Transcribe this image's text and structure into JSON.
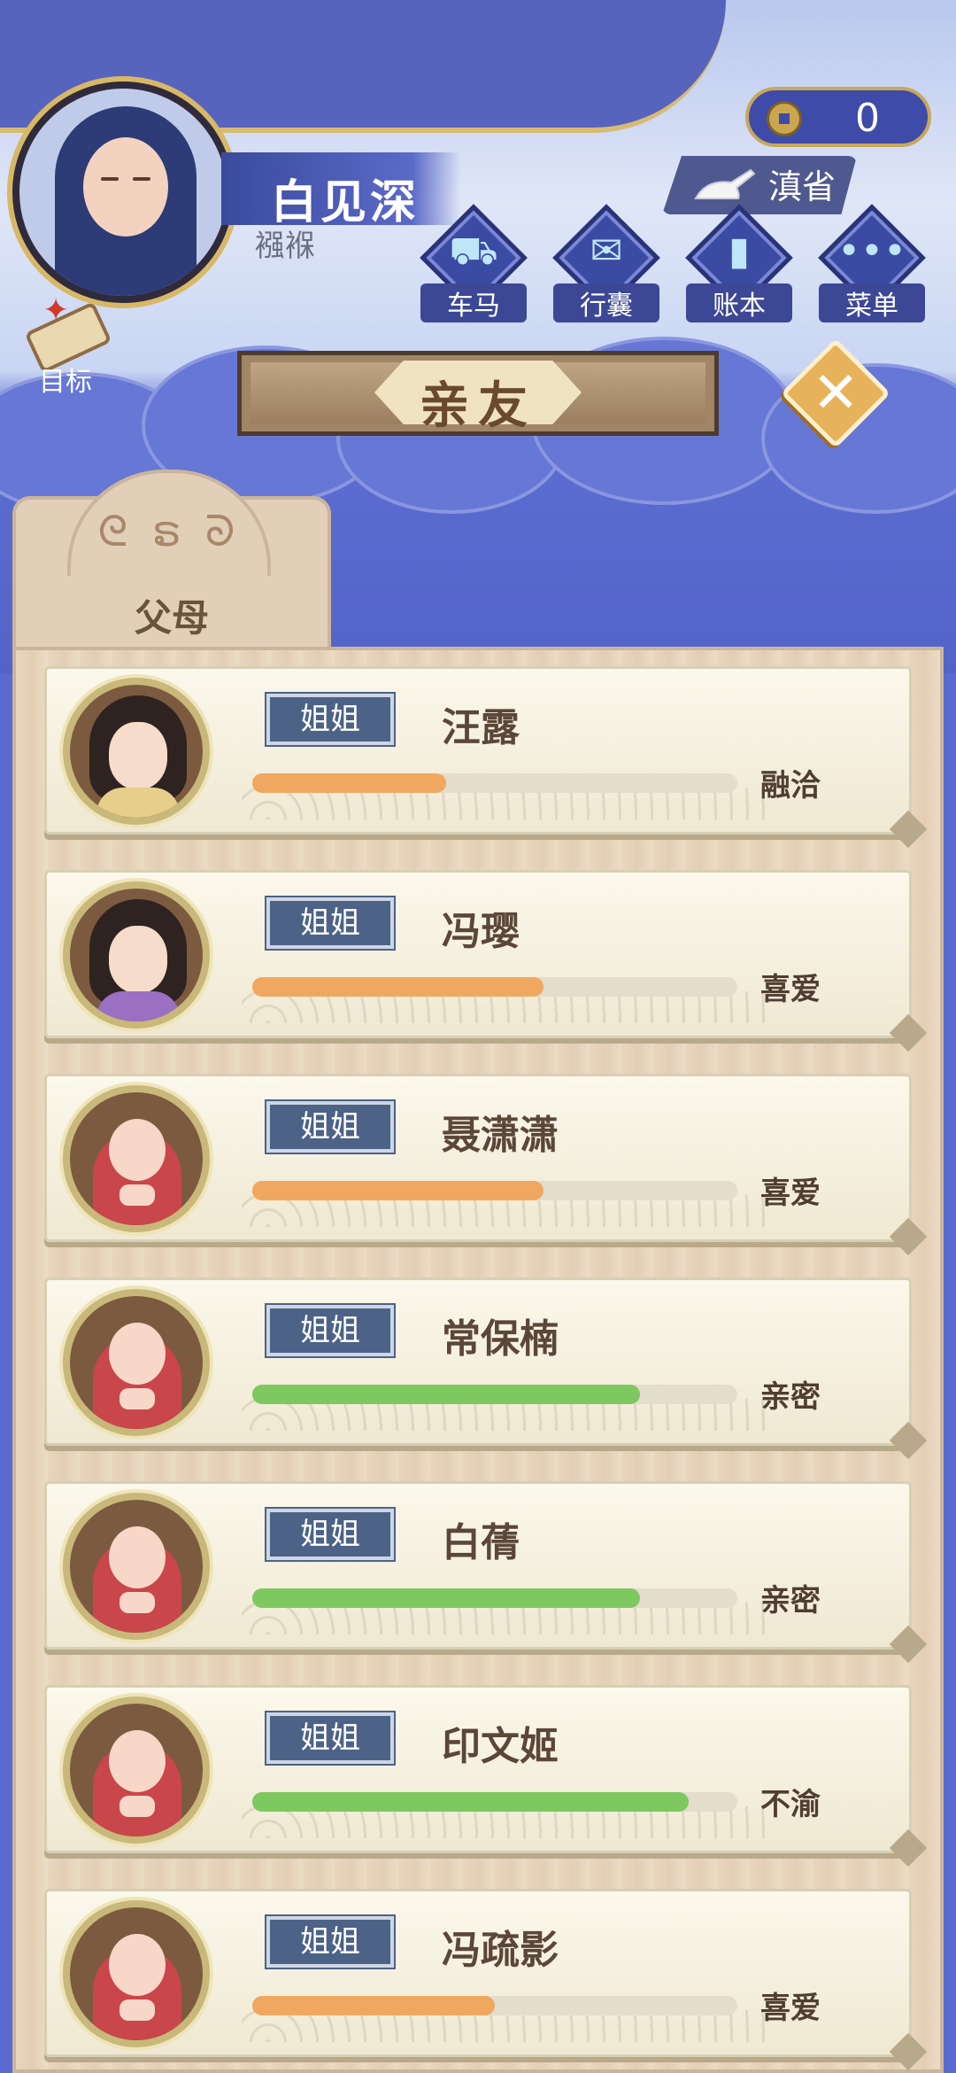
{
  "player": {
    "name": "白见深",
    "title": "襁褓"
  },
  "currency": {
    "coins": "0"
  },
  "location": {
    "name": "滇省"
  },
  "menu": [
    {
      "label": "车马",
      "icon": "carriage-icon"
    },
    {
      "label": "行囊",
      "icon": "bundle-icon"
    },
    {
      "label": "账本",
      "icon": "ledger-icon"
    },
    {
      "label": "菜单",
      "icon": "more-icon"
    }
  ],
  "target": {
    "label": "目标"
  },
  "dialog": {
    "title": "亲友"
  },
  "tabs": {
    "active": "父母"
  },
  "relatives": [
    {
      "relation": "姐姐",
      "name": "汪露",
      "status": "融洽",
      "affinity": 0.4,
      "color": "#f0a860",
      "avatar": "girl",
      "robe": "#e7cf8a"
    },
    {
      "relation": "姐姐",
      "name": "冯璎",
      "status": "喜爱",
      "affinity": 0.6,
      "color": "#f0a860",
      "avatar": "girl",
      "robe": "#9b6fc2"
    },
    {
      "relation": "姐姐",
      "name": "聂潇潇",
      "status": "喜爱",
      "affinity": 0.6,
      "color": "#f0a860",
      "avatar": "baby"
    },
    {
      "relation": "姐姐",
      "name": "常保楠",
      "status": "亲密",
      "affinity": 0.8,
      "color": "#7ec860",
      "avatar": "baby"
    },
    {
      "relation": "姐姐",
      "name": "白蒨",
      "status": "亲密",
      "affinity": 0.8,
      "color": "#7ec860",
      "avatar": "baby"
    },
    {
      "relation": "姐姐",
      "name": "印文姬",
      "status": "不渝",
      "affinity": 0.9,
      "color": "#7ec860",
      "avatar": "baby"
    },
    {
      "relation": "姐姐",
      "name": "冯疏影",
      "status": "喜爱",
      "affinity": 0.5,
      "color": "#f0a860",
      "avatar": "baby"
    }
  ]
}
